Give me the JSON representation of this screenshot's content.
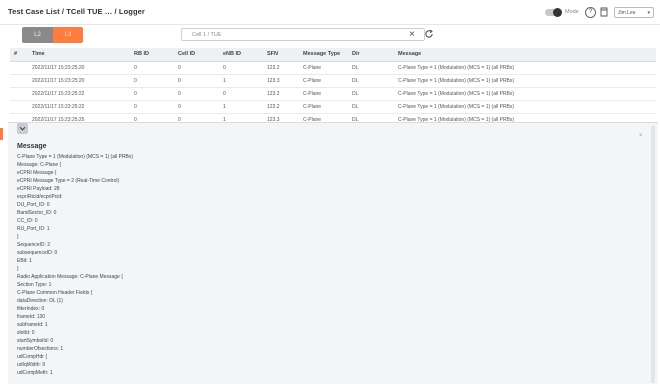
{
  "header": {
    "title": "Test Case List / TCell TUE … / Logger",
    "mode_label": "Mode",
    "help_glyph": "?",
    "user_select_value": "Jim Lee"
  },
  "filter": {
    "btn_left": "L2",
    "btn_right": "L3",
    "search_value": "Cell 1 / TUE"
  },
  "table": {
    "columns": [
      "#",
      "Time",
      "RB ID",
      "Cell ID",
      "eNB ID",
      "SFN",
      "Message Type",
      "Dir",
      "Message"
    ],
    "rows": [
      [
        "",
        "2022/11/17 15:23:25:20",
        "0",
        "0",
        "0",
        "123.2",
        "C-Plane",
        "DL",
        "C-Plane Type = 1 (Modulation) (MCS = 1) (all PRBs)"
      ],
      [
        "",
        "2022/11/17 15:23:25:20",
        "0",
        "0",
        "1",
        "123.3",
        "C-Plane",
        "DL",
        "C-Plane Type = 1 (Modulation) (MCS = 1) (all PRBs)"
      ],
      [
        "",
        "2022/11/17 15:23:25:22",
        "0",
        "0",
        "0",
        "123.2",
        "C-Plane",
        "DL",
        "C-Plane Type = 1 (Modulation) (MCS = 1) (all PRBs)"
      ],
      [
        "",
        "2022/11/17 15:23:25:22",
        "0",
        "0",
        "1",
        "123.2",
        "C-Plane",
        "DL",
        "C-Plane Type = 1 (Modulation) (MCS = 1) (all PRBs)"
      ],
      [
        "",
        "2022/11/17 15:23:25:25",
        "0",
        "0",
        "1",
        "123.3",
        "C-Plane",
        "DL",
        "C-Plane Type = 1 (Modulation) (MCS = 1) (all PRBs)"
      ]
    ]
  },
  "detail": {
    "heading": "Message",
    "lines": [
      "C-Plane Type = 1 (Modulation) (MCS = 1) (all PRBs)",
      "Message: C-Plane {",
      "eCPRI Message {",
      "eCPRI Message Type = 2 (Real-Time Control)",
      "eCPRI Payload: 28",
      "ecpriRtcid/ecpriPcid:",
      "DU_Port_ID: 0",
      "BandSector_ID: 0",
      "CC_ID: 0",
      "RU_Port_ID: 1",
      "}",
      "SequenceID: 2",
      "subsequenceID: 0",
      "EBit: 1",
      "}",
      "Radio Application Message: C-Plane Message {",
      "Section Type: 1",
      "C-Plane Common Header Fields {",
      "dataDirection: DL (1)",
      "filterIndex: 0",
      "frameId: 130",
      "subframeId: 1",
      "slotId: 0",
      "startSymbolId: 0",
      "numberOfsections: 1",
      "udCompHdr {",
      "udIqWidth: 9",
      "udCompMeth: 1"
    ]
  }
}
